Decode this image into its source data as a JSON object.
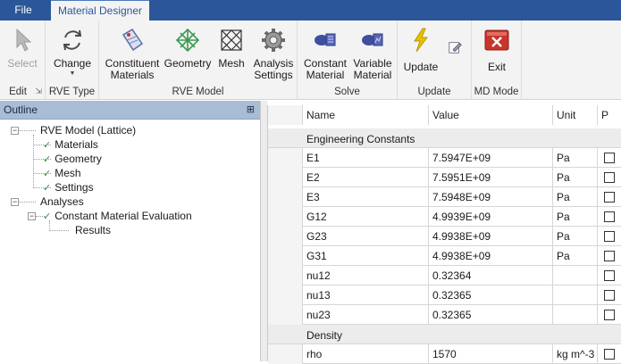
{
  "tabs": {
    "file": "File",
    "material_designer": "Material Designer"
  },
  "ribbon": {
    "groups": {
      "edit": "Edit",
      "rve_type": "RVE Type",
      "rve_model": "RVE Model",
      "solve": "Solve",
      "update": "Update",
      "md_mode": "MD Mode"
    },
    "buttons": {
      "select": "Select",
      "change": "Change",
      "constituent_materials": "Constituent Materials",
      "geometry": "Geometry",
      "mesh": "Mesh",
      "analysis_settings": "Analysis Settings",
      "constant_material": "Constant Material",
      "variable_material": "Variable Material",
      "update": "Update",
      "exit": "Exit"
    },
    "colors": {
      "accent": "#2b579a",
      "exit_red": "#c8352a",
      "geometry_green": "#3a9a52",
      "update_yellow": "#e8c200"
    }
  },
  "outline": {
    "title": "Outline",
    "pin_icon": "pin-icon",
    "nodes": {
      "rve_model": "RVE Model (Lattice)",
      "materials": "Materials",
      "geometry": "Geometry",
      "mesh": "Mesh",
      "settings": "Settings",
      "analyses": "Analyses",
      "constant_eval": "Constant Material Evaluation",
      "results": "Results"
    }
  },
  "grid": {
    "headers": {
      "name": "Name",
      "value": "Value",
      "unit": "Unit",
      "p": "P"
    },
    "sections": {
      "engineering": "Engineering Constants",
      "density": "Density"
    },
    "engineering_rows": [
      {
        "name": "E1",
        "value": "7.5947E+09",
        "unit": "Pa"
      },
      {
        "name": "E2",
        "value": "7.5951E+09",
        "unit": "Pa"
      },
      {
        "name": "E3",
        "value": "7.5948E+09",
        "unit": "Pa"
      },
      {
        "name": "G12",
        "value": "4.9939E+09",
        "unit": "Pa"
      },
      {
        "name": "G23",
        "value": "4.9938E+09",
        "unit": "Pa"
      },
      {
        "name": "G31",
        "value": "4.9938E+09",
        "unit": "Pa"
      },
      {
        "name": "nu12",
        "value": "0.32364",
        "unit": ""
      },
      {
        "name": "nu13",
        "value": "0.32365",
        "unit": ""
      },
      {
        "name": "nu23",
        "value": "0.32365",
        "unit": ""
      }
    ],
    "density_rows": [
      {
        "name": "rho",
        "value": "1570",
        "unit": "kg m^-3"
      }
    ]
  }
}
